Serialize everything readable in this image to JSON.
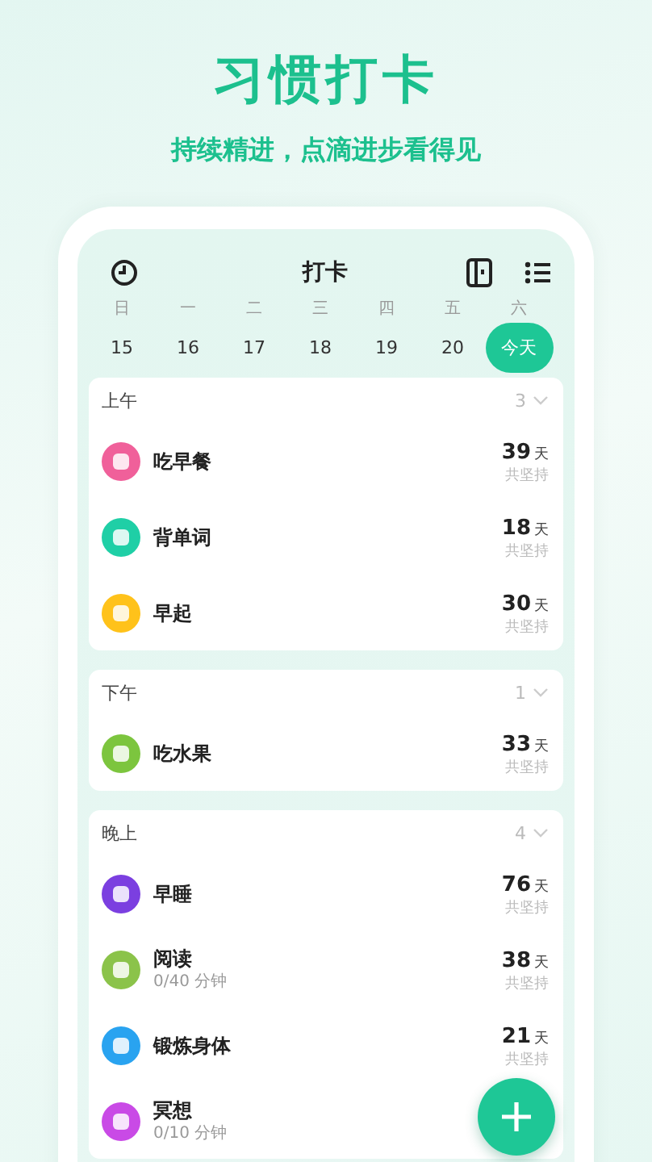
{
  "headline": "习惯打卡",
  "tagline": "持续精进，点滴进步看得见",
  "app": {
    "title": "打卡",
    "weekdays": [
      "日",
      "一",
      "二",
      "三",
      "四",
      "五",
      "六"
    ],
    "dates": [
      {
        "label": "15",
        "selected": false
      },
      {
        "label": "16",
        "selected": false
      },
      {
        "label": "17",
        "selected": false
      },
      {
        "label": "18",
        "selected": false
      },
      {
        "label": "19",
        "selected": false
      },
      {
        "label": "20",
        "selected": false
      },
      {
        "label": "今天",
        "selected": true
      }
    ],
    "sections": [
      {
        "title": "上午",
        "count": "3",
        "habits": [
          {
            "name": "吃早餐",
            "color": "#f0609a",
            "days": "39",
            "unit": "天",
            "caption": "共坚持"
          },
          {
            "name": "背单词",
            "color": "#1fcfa6",
            "days": "18",
            "unit": "天",
            "caption": "共坚持"
          },
          {
            "name": "早起",
            "color": "#ffc21a",
            "days": "30",
            "unit": "天",
            "caption": "共坚持"
          }
        ]
      },
      {
        "title": "下午",
        "count": "1",
        "habits": [
          {
            "name": "吃水果",
            "color": "#7cc53e",
            "days": "33",
            "unit": "天",
            "caption": "共坚持"
          }
        ]
      },
      {
        "title": "晚上",
        "count": "4",
        "habits": [
          {
            "name": "早睡",
            "color": "#7b3fe0",
            "days": "76",
            "unit": "天",
            "caption": "共坚持"
          },
          {
            "name": "阅读",
            "detail": "0/40 分钟",
            "color": "#8bc34a",
            "days": "38",
            "unit": "天",
            "caption": "共坚持"
          },
          {
            "name": "锻炼身体",
            "color": "#29a3f0",
            "days": "21",
            "unit": "天",
            "caption": "共坚持"
          },
          {
            "name": "冥想",
            "detail": "0/10 分钟",
            "color": "#c94ae6"
          }
        ]
      }
    ]
  }
}
